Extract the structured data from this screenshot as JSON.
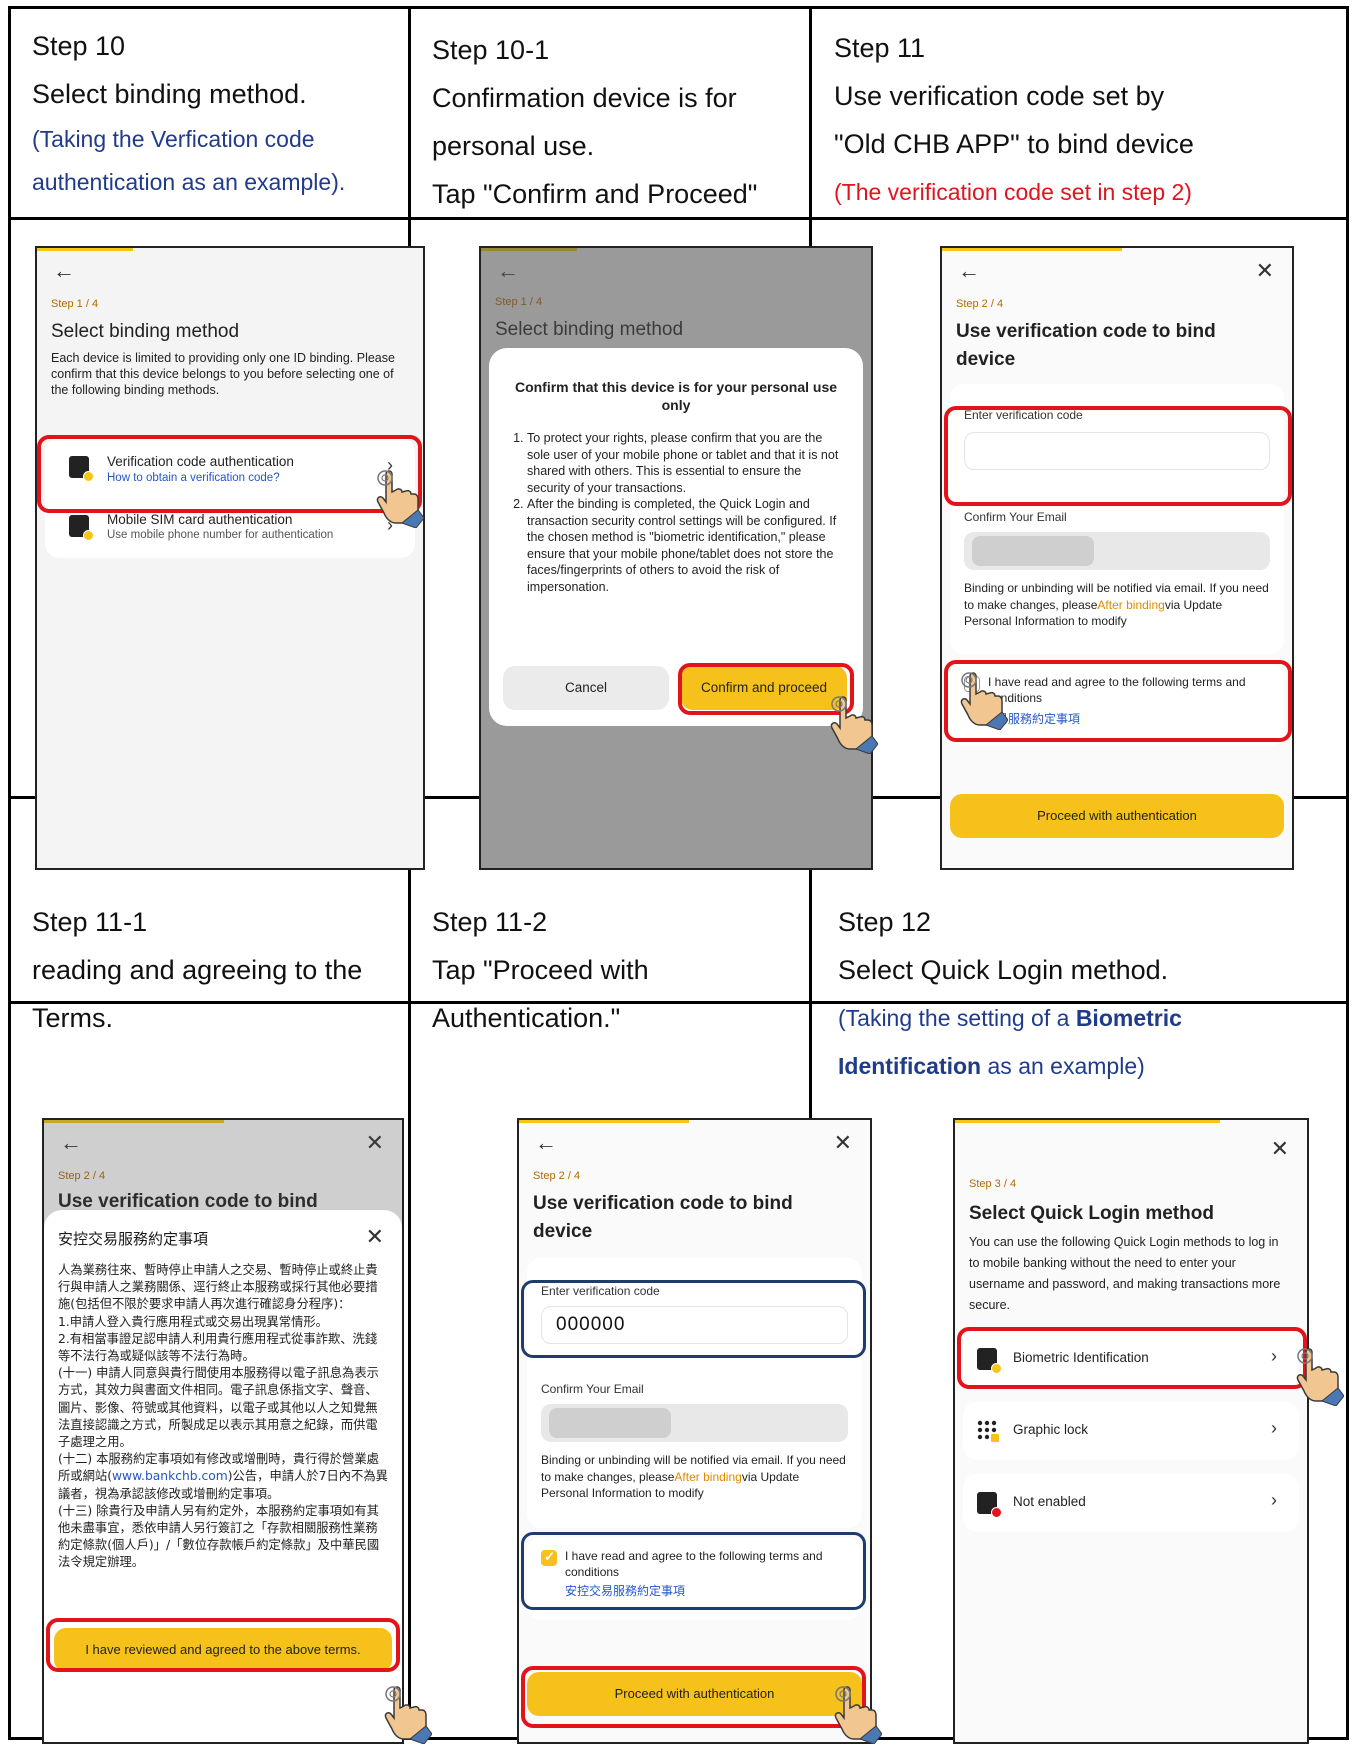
{
  "cells": {
    "step10": {
      "title": "Step 10",
      "line1": "Select binding method.",
      "note1": "(Taking the Verfication code",
      "note2": "authentication as an example)."
    },
    "step10_1": {
      "title": "Step 10-1",
      "line1": "Confirmation device is for",
      "line2": "personal use.",
      "line3": "Tap \"Confirm and Proceed\""
    },
    "step11": {
      "title": "Step 11",
      "line1": "Use verification code set by",
      "line2": "\"Old CHB APP\" to bind device",
      "note": "(The verification code set in step 2)"
    },
    "step11_1": {
      "title": "Step 11-1",
      "line1": "reading and agreeing to the",
      "line2": "Terms."
    },
    "step11_2": {
      "title": "Step 11-2",
      "line1": "Tap \"Proceed with",
      "line2": "Authentication.\""
    },
    "step12": {
      "title": "Step 12",
      "line1": "Select Quick Login method.",
      "note_pre": "(Taking the setting of a ",
      "note_bold1": "Biometric",
      "note_bold2": "Identification",
      "note_post": " as an example)"
    }
  },
  "icons": {
    "back": "←",
    "close": "✕",
    "chevron": "›"
  },
  "screen_binding": {
    "step": "Step 1 / 4",
    "title": "Select binding method",
    "desc": "Each device is limited to providing only one ID binding. Please confirm that this device belongs to you before selecting one of the following binding methods.",
    "opt1_title": "Verification code authentication",
    "opt1_sub": "How to obtain a verification code?",
    "opt2_title": "Mobile SIM card authentication",
    "opt2_sub": "Use mobile phone number for authentication"
  },
  "modal_personal": {
    "title": "Confirm that this device is for your personal use only",
    "item1": "To protect your rights, please confirm that you are the sole user of your mobile phone or tablet and that it is not shared with others. This is essential to ensure the security of your transactions.",
    "item2": "After the binding is completed, the Quick Login and transaction security control settings will be configured. If the chosen method is \"biometric identification,\" please ensure that your mobile phone/tablet does not store the faces/fingerprints of others to avoid the risk of impersonation.",
    "cancel": "Cancel",
    "confirm": "Confirm and proceed"
  },
  "screen_verify": {
    "step": "Step 2 / 4",
    "title": "Use verification code to bind device",
    "code_label": "Enter verification code",
    "code_value": "000000",
    "email_label": "Confirm Your Email",
    "note_pre": "Binding or unbinding will be notified via email. If you need to make changes, please",
    "note_link": "After binding",
    "note_post": "via Update Personal Information to modify",
    "terms": "I have read and agree to the following terms and conditions",
    "terms_link": "安控交易服務約定事項",
    "terms_link_partial": "易服務約定事項",
    "terms_partial_line2": "itions",
    "proceed": "Proceed with authentication"
  },
  "sheet_terms": {
    "title": "安控交易服務約定事項",
    "body1": "人為業務往來、暫時停止申請人之交易、暫時停止或終止貴行與申請人之業務關係、逕行終止本服務或採行其他必要措施(包括但不限於要求申請人再次進行確認身分程序)：",
    "body2": "1.申請人登入貴行應用程式或交易出現異常情形。",
    "body3": "2.有相當事證足認申請人利用貴行應用程式從事詐欺、洗錢等不法行為或疑似該等不法行為時。",
    "body4": "(十一) 申請人同意與貴行間使用本服務得以電子訊息為表示方式，其效力與書面文件相同。電子訊息係指文字、聲音、圖片、影像、符號或其他資料，以電子或其他以人之知覺無法直接認識之方式，所製成足以表示其用意之紀錄，而供電子處理之用。",
    "body5_pre": "(十二) 本服務約定事項如有修改或增刪時，貴行得於營業處所或網站(",
    "body5_link": "www.bankchb.com",
    "body5_post": ")公告，申請人於7日內不為異議者，視為承認該修改或增刪約定事項。",
    "body6": "(十三) 除貴行及申請人另有約定外，本服務約定事項如有其他未盡事宜，悉依申請人另行簽訂之「存款相關服務性業務約定條款(個人戶)」/「數位存款帳戶約定條款」及中華民國法令規定辦理。",
    "agree": "I have reviewed and agreed to the above terms."
  },
  "screen_quick": {
    "step": "Step 3 / 4",
    "title": "Select Quick Login method",
    "desc": "You can use the following Quick Login methods to log in to mobile banking without the need to enter your username and password, and making transactions more secure.",
    "opt1": "Biometric Identification",
    "opt2": "Graphic lock",
    "opt3": "Not enabled"
  },
  "colors": {
    "accent_yellow": "#f7c11c",
    "highlight_red": "#e3131c",
    "highlight_blue": "#1e3c6e",
    "note_blue": "#1f3b8a",
    "note_red": "#e0141e"
  }
}
